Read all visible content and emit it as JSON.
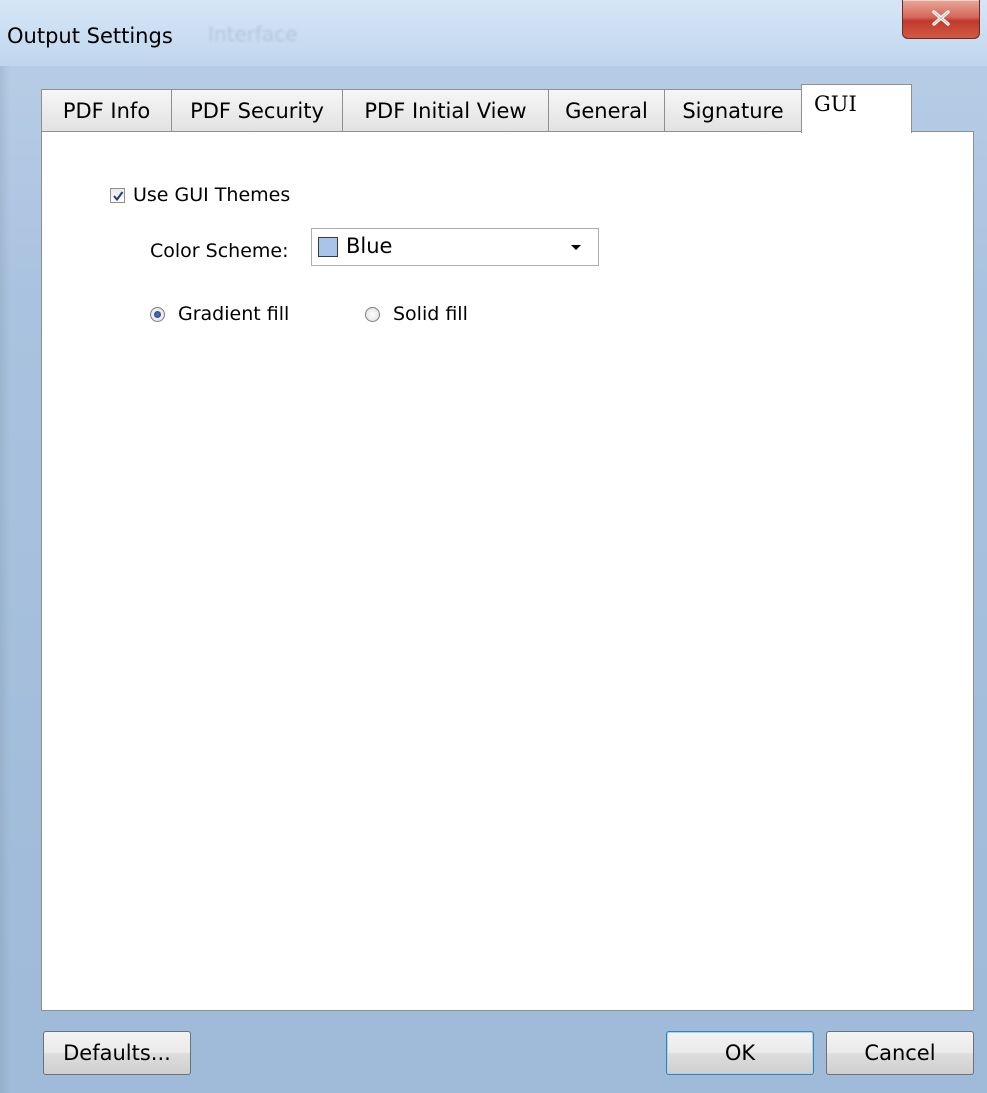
{
  "window": {
    "title": "Output Settings",
    "title_obscured": "Interface",
    "colors": {
      "frame": "#b7cde6",
      "close": "#c1392b",
      "accent": "#3c7fb1"
    }
  },
  "tabs": [
    {
      "label": "PDF Info",
      "active": false
    },
    {
      "label": "PDF Security",
      "active": false
    },
    {
      "label": "PDF Initial View",
      "active": false
    },
    {
      "label": "General",
      "active": false
    },
    {
      "label": "Signature",
      "active": false
    },
    {
      "label": "GUI",
      "active": true
    }
  ],
  "gui": {
    "use_themes": {
      "label": "Use GUI Themes",
      "checked": true
    },
    "color_scheme": {
      "label": "Color Scheme:",
      "value": "Blue",
      "swatch_color": "#a8c4ea"
    },
    "fill": [
      {
        "label": "Gradient fill",
        "selected": true
      },
      {
        "label": "Solid fill",
        "selected": false
      }
    ]
  },
  "buttons": {
    "defaults": "Defaults...",
    "ok": "OK",
    "cancel": "Cancel"
  },
  "icons": {
    "close": "close-icon",
    "check": "checkmark-icon",
    "dropdown": "chevron-down-icon"
  }
}
